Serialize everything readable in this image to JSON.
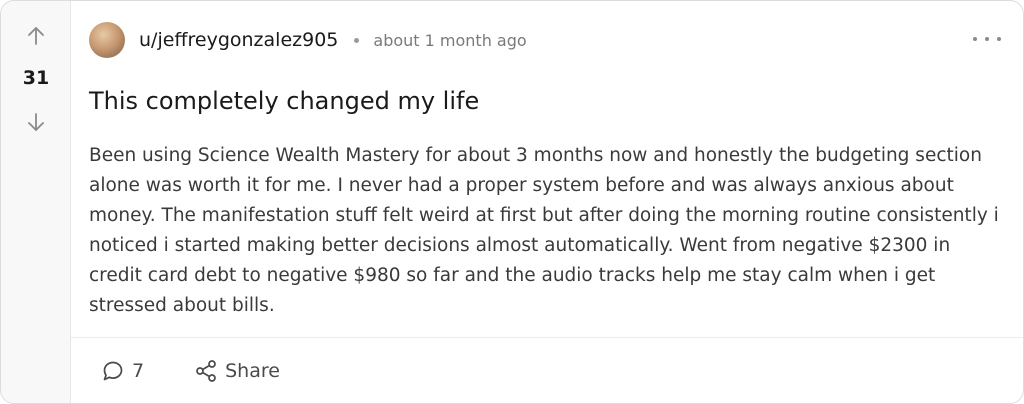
{
  "post": {
    "score": "31",
    "username": "u/jeffreygonzalez905",
    "timestamp": "about 1 month ago",
    "title": "This completely changed my life",
    "body": "Been using Science Wealth Mastery for about 3 months now and honestly the budgeting section alone was worth it for me. I never had a proper system before and was always anxious about money. The manifestation stuff felt weird at first but after doing the morning routine consistently i noticed i started making better decisions almost automatically. Went from negative $2300 in credit card debt to negative $980 so far and the audio tracks help me stay calm when i get stressed about bills."
  },
  "actions": {
    "comment_count": "7",
    "share_label": "Share"
  },
  "icons": {
    "upvote": "arrow-up-icon",
    "downvote": "arrow-down-icon",
    "more": "more-horizontal-icon",
    "comment": "comment-bubble-icon",
    "share": "share-nodes-icon"
  },
  "colors": {
    "rail_background": "#f8f8f9",
    "text_primary": "#1a1a1b",
    "text_muted": "#7a7a7a"
  }
}
